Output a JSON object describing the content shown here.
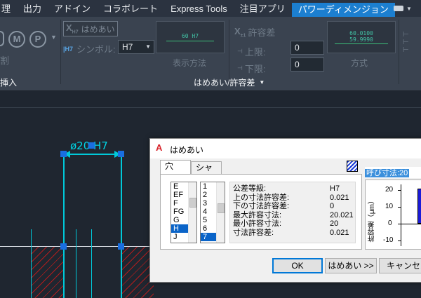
{
  "ribbon_tabs": [
    "理",
    "出力",
    "アドイン",
    "コラボレート",
    "Express Tools",
    "注目アプリ",
    "パワーディメンジョン"
  ],
  "ribbon": {
    "left_panel_title": "挿入",
    "left_panel_partial": "割",
    "fit_button_label": "はめあい",
    "symbol_label": "シンボル:",
    "symbol_value": "H7",
    "display_method_label": "表示方法",
    "display_preview": "60 H7",
    "tolerance_label": "許容差",
    "upper_label": "上限:",
    "upper_value": "0",
    "lower_label": "下限:",
    "lower_value": "0",
    "method_label": "方式",
    "method_preview_top": "60.0100",
    "method_preview_bottom": "59.9990",
    "panel_title": "はめあい/許容差"
  },
  "drawing": {
    "dim_text": "ø20 H7"
  },
  "dialog": {
    "title": "はめあい",
    "tab_hole": "穴",
    "tab_shaft": "シャフト",
    "letters": [
      "E",
      "EF",
      "F",
      "FG",
      "G",
      "H",
      "J"
    ],
    "selected_letter": "H",
    "grades": [
      "1",
      "2",
      "3",
      "4",
      "5",
      "6",
      "7"
    ],
    "selected_grade": "7",
    "info_labels": [
      "公差等級:",
      "上の寸法許容差:",
      "下の寸法許容差:",
      "最大許容寸法:",
      "最小許容寸法:",
      "寸法許容差:"
    ],
    "info_values": [
      "H7",
      "0.021",
      "0",
      "20.021",
      "20",
      "0.021"
    ],
    "nominal_label": "呼び寸法:20",
    "chart_axis_label": "許容差（μm）",
    "chart_ticks": [
      "20",
      "10",
      "0",
      "-10"
    ],
    "ok_label": "OK",
    "fit_button": "はめあい >>",
    "cancel_label": "キャンセル"
  }
}
